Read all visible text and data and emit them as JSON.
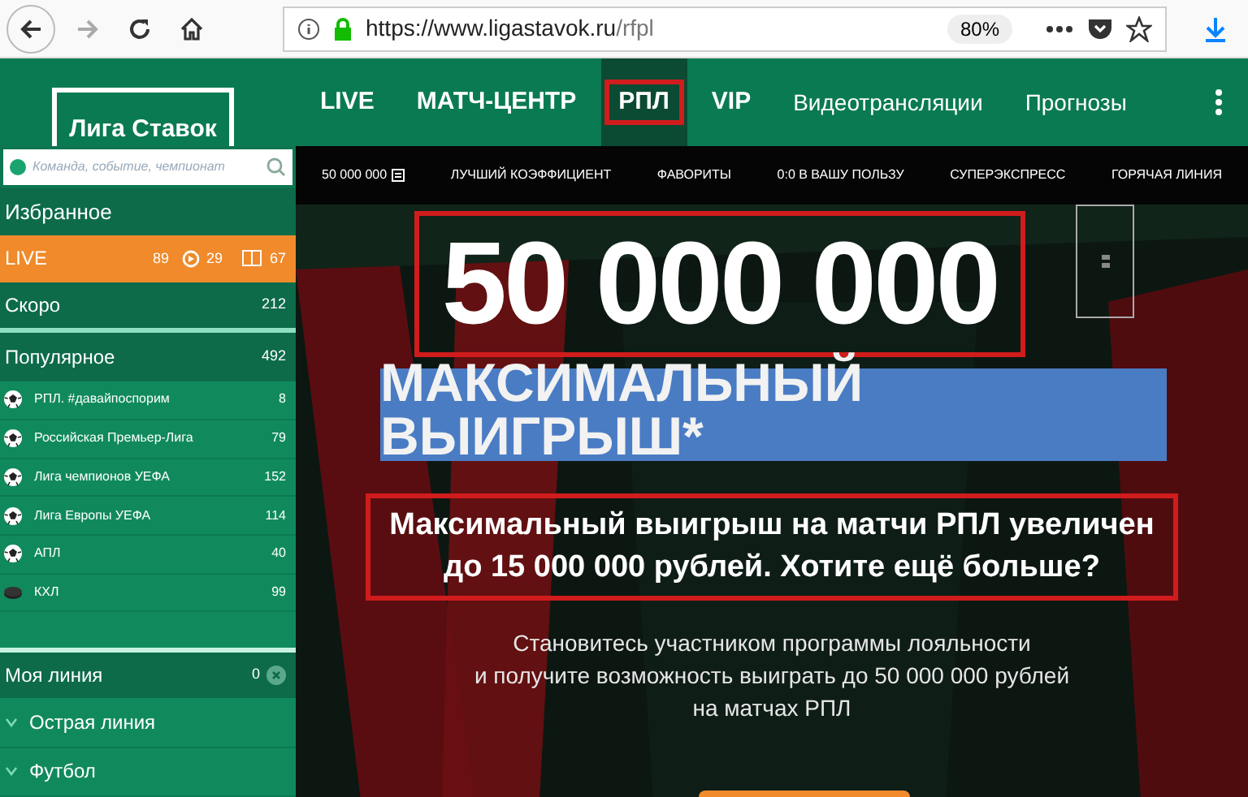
{
  "browser": {
    "url_host": "https://www.ligastavok.ru",
    "url_path": "/rfpl",
    "zoom": "80%"
  },
  "header": {
    "logo": "Лига Ставок",
    "nav": [
      {
        "label": "LIVE",
        "selected": false,
        "highlighted": false
      },
      {
        "label": "МАТЧ-ЦЕНТР",
        "selected": false,
        "highlighted": false
      },
      {
        "label": "РПЛ",
        "selected": true,
        "highlighted": true
      },
      {
        "label": "VIP",
        "selected": false,
        "highlighted": false
      },
      {
        "label": "Видеотрансляции",
        "selected": false,
        "highlighted": false
      },
      {
        "label": "Прогнозы",
        "selected": false,
        "highlighted": false
      }
    ]
  },
  "sidebar": {
    "search": {
      "placeholder": "Команда, событие, чемпионат"
    },
    "favorites": "Избранное",
    "live": {
      "label": "LIVE",
      "count": "89",
      "video_count": "29",
      "scoreboard_count": "67"
    },
    "soon": {
      "label": "Скоро",
      "count": "212"
    },
    "popular": {
      "label": "Популярное",
      "count": "492",
      "items": [
        {
          "label": "РПЛ. #давайпоспорим",
          "count": "8",
          "kind": "football"
        },
        {
          "label": "Российская Премьер-Лига",
          "count": "79",
          "kind": "football"
        },
        {
          "label": "Лига чемпионов УЕФА",
          "count": "152",
          "kind": "football"
        },
        {
          "label": "Лига Европы УЕФА",
          "count": "114",
          "kind": "football"
        },
        {
          "label": "АПЛ",
          "count": "40",
          "kind": "football"
        },
        {
          "label": "КХЛ",
          "count": "99",
          "kind": "hockey"
        }
      ]
    },
    "my_line": {
      "label": "Моя линия",
      "count": "0"
    },
    "sections": [
      {
        "label": "Острая линия",
        "expanded": false
      },
      {
        "label": "Футбол",
        "expanded": false
      }
    ]
  },
  "promo_tabs": [
    {
      "label": "50 000 000"
    },
    {
      "label": "ЛУЧШИЙ КОЭФФИЦИЕНТ"
    },
    {
      "label": "ФАВОРИТЫ"
    },
    {
      "label": "0:0 В ВАШУ ПОЛЬЗУ"
    },
    {
      "label": "СУПЕРЭКСПРЕСС"
    },
    {
      "label": "ГОРЯЧАЯ ЛИНИЯ"
    }
  ],
  "hero": {
    "amount": "50 000 000",
    "amount_highlighted": true,
    "headline": "МАКСИМАЛЬНЫЙ\nВЫИГРЫШ*",
    "subtitle": "Максимальный выигрыш на матчи РПЛ увеличен до 15 000 000 рублей. Хотите ещё больше?",
    "subtitle_highlighted": true,
    "description": "Становитесь участником программы лояльности\nи получите возможность выиграть до 50 000 000 рублей\nна матчах РПЛ"
  }
}
